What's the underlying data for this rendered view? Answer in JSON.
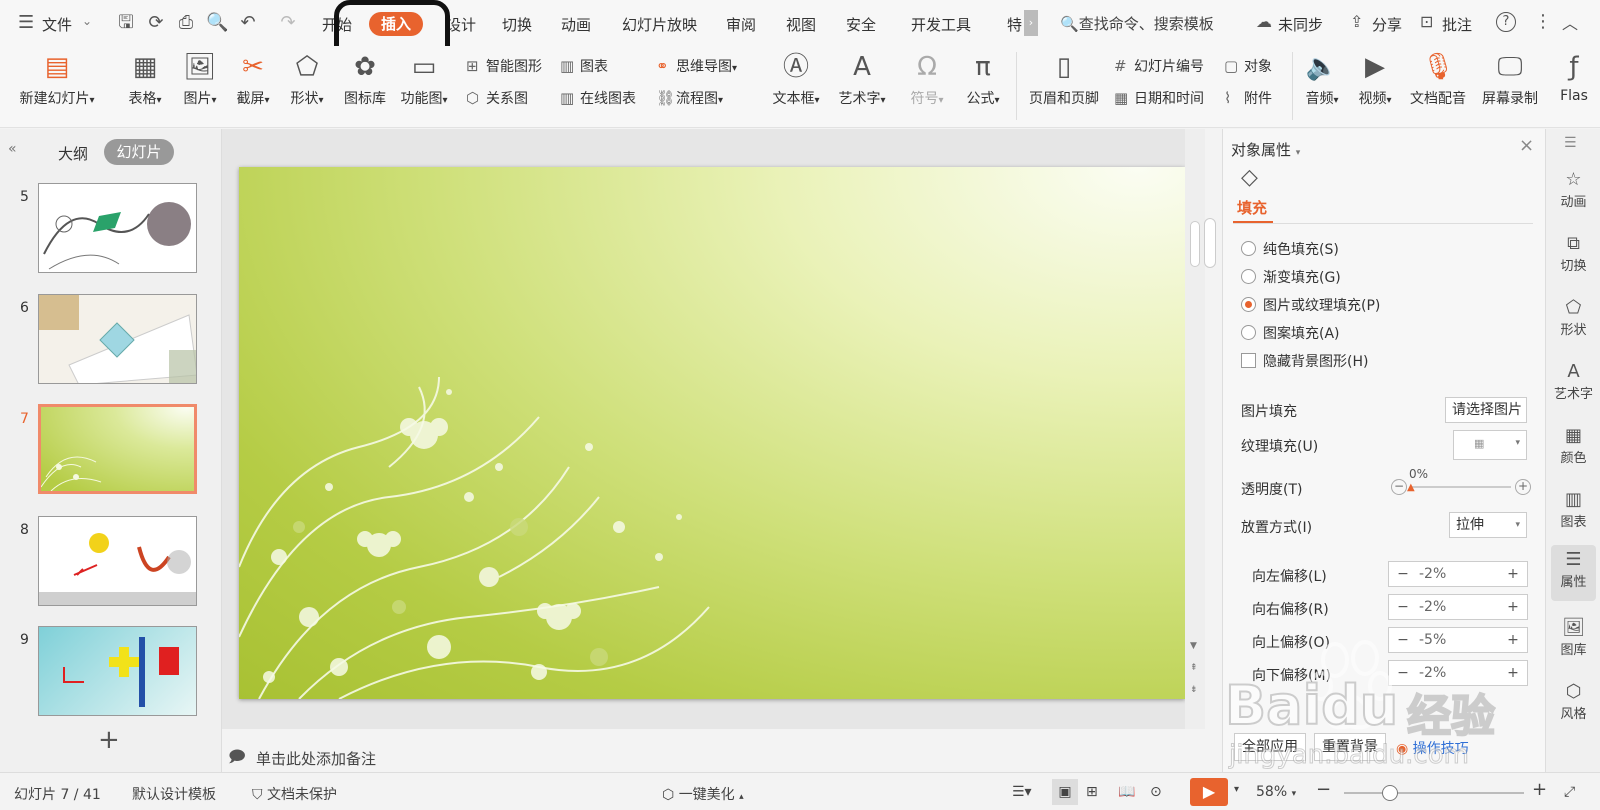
{
  "menu": {
    "file": "文件",
    "tabs": [
      "开始",
      "插入",
      "设计",
      "切换",
      "动画",
      "幻灯片放映",
      "审阅",
      "视图",
      "安全",
      "开发工具",
      "特"
    ],
    "search_placeholder": "查找命令、搜索模板",
    "unsynced": "未同步",
    "share": "分享",
    "comment": "批注"
  },
  "ribbon": {
    "new_slide": "新建幻灯片",
    "table": "表格",
    "picture": "图片",
    "screenshot": "截屏",
    "shape": "形状",
    "icon_lib": "图标库",
    "func_chart": "功能图",
    "smart_art": "智能图形",
    "chart": "图表",
    "mind_map": "思维导图",
    "relation": "关系图",
    "online_chart": "在线图表",
    "flowchart": "流程图",
    "textbox": "文本框",
    "word_art": "艺术字",
    "symbol": "符号",
    "formula": "公式",
    "header_footer": "页眉和页脚",
    "slide_number": "幻灯片编号",
    "object": "对象",
    "date_time": "日期和时间",
    "attachment": "附件",
    "audio": "音频",
    "video": "视频",
    "doc_voice": "文档配音",
    "screen_record": "屏幕录制",
    "flash": "Flas"
  },
  "left_panel": {
    "tab_outline": "大纲",
    "tab_slides": "幻灯片",
    "slide_numbers": [
      "5",
      "6",
      "7",
      "8",
      "9"
    ],
    "selected": "7"
  },
  "notes_placeholder": "单击此处添加备注",
  "properties": {
    "title": "对象属性",
    "fill_tab": "填充",
    "options": [
      "纯色填充(S)",
      "渐变填充(G)",
      "图片或纹理填充(P)",
      "图案填充(A)"
    ],
    "selected_option": "图片或纹理填充(P)",
    "hide_bg": "隐藏背景图形(H)",
    "picture_fill_label": "图片填充",
    "picture_fill_value": "请选择图片",
    "texture_fill_label": "纹理填充(U)",
    "transparency_label": "透明度(T)",
    "transparency_value": "0%",
    "placement_label": "放置方式(I)",
    "placement_value": "拉伸",
    "offsets": [
      {
        "label": "向左偏移(L)",
        "value": "-2%"
      },
      {
        "label": "向右偏移(R)",
        "value": "-2%"
      },
      {
        "label": "向上偏移(O)",
        "value": "-5%"
      },
      {
        "label": "向下偏移(M)",
        "value": "-2%"
      }
    ],
    "apply_all": "全部应用",
    "reset_bg": "重置背景",
    "tips": "操作技巧"
  },
  "icon_strip": [
    "动画",
    "切换",
    "形状",
    "艺术字",
    "颜色",
    "图表",
    "属性",
    "图库",
    "风格"
  ],
  "status": {
    "slide_info": "幻灯片 7 / 41",
    "template": "默认设计模板",
    "protection": "文档未保护",
    "beautify": "一键美化",
    "zoom": "58%"
  },
  "watermark": {
    "brand": "Baidu",
    "cn": "经验",
    "url": "jingyan.baidu.com"
  },
  "colors": {
    "accent": "#e8632e",
    "slide_green": "#b5cc45"
  }
}
